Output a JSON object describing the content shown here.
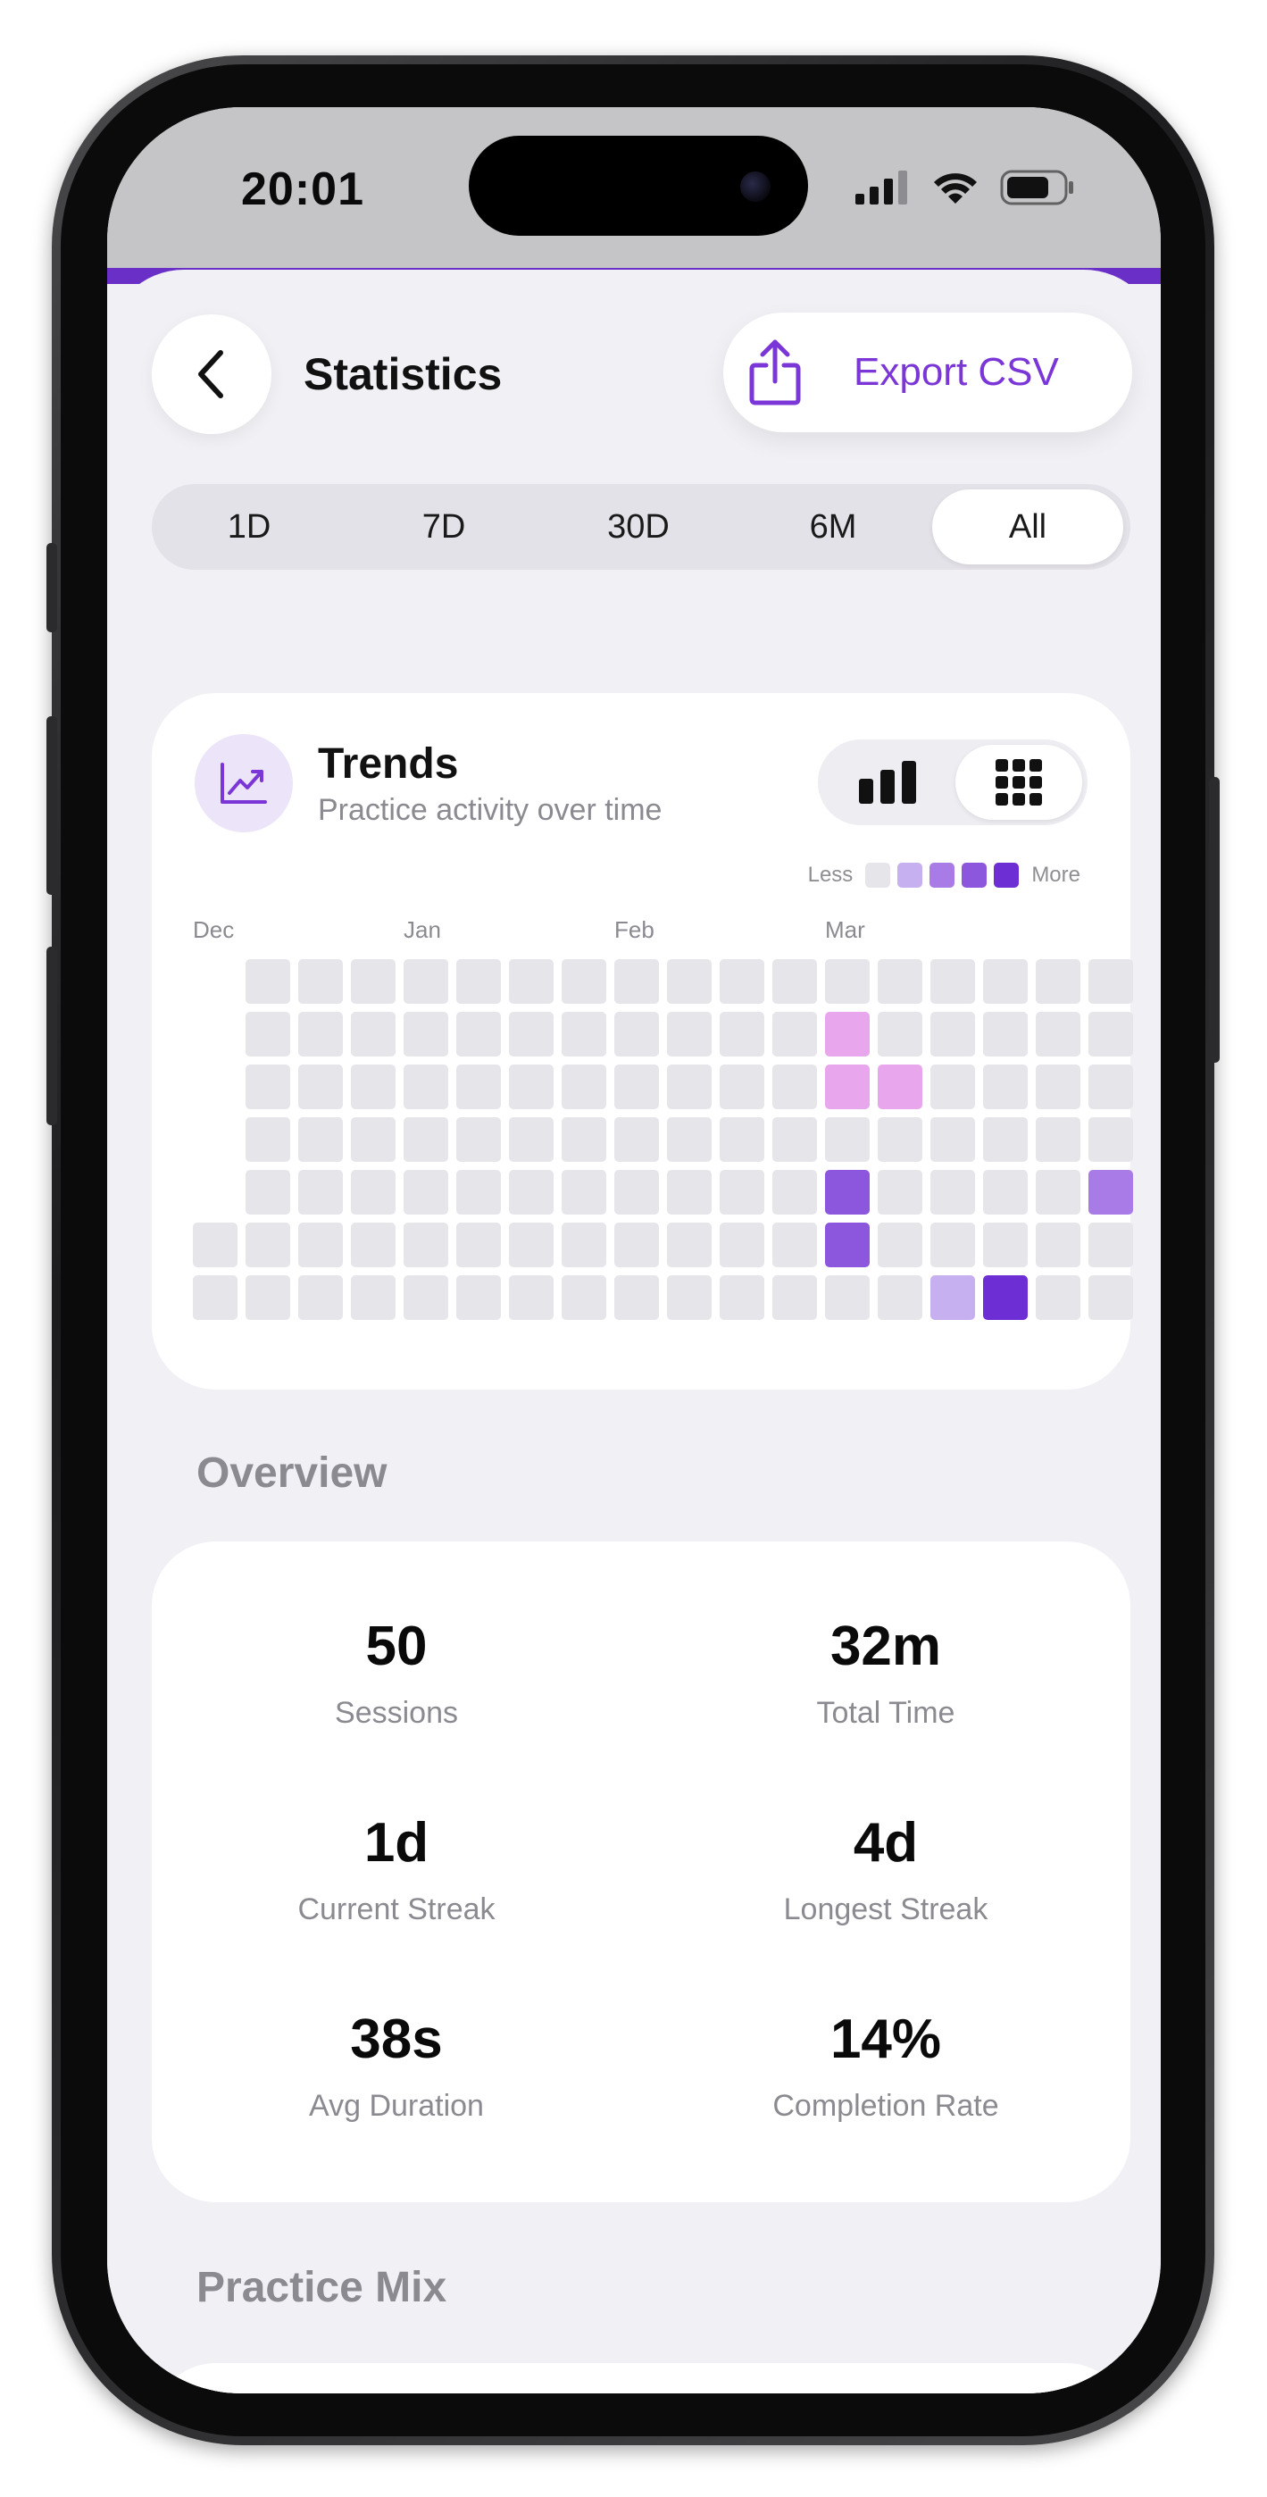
{
  "status_bar": {
    "time": "20:01"
  },
  "nav": {
    "title": "Statistics",
    "export_label": "Export CSV"
  },
  "ranges": [
    {
      "label": "1D",
      "active": false
    },
    {
      "label": "7D",
      "active": false
    },
    {
      "label": "30D",
      "active": false
    },
    {
      "label": "6M",
      "active": false
    },
    {
      "label": "All",
      "active": true
    }
  ],
  "trends": {
    "title": "Trends",
    "subtitle": "Practice activity over time",
    "view_modes": [
      {
        "icon": "bar-chart-icon",
        "active": false
      },
      {
        "icon": "grid-icon",
        "active": true
      }
    ],
    "legend": {
      "less": "Less",
      "more": "More"
    },
    "months": [
      {
        "label": "Dec",
        "week": 0
      },
      {
        "label": "Jan",
        "week": 4
      },
      {
        "label": "Feb",
        "week": 8
      },
      {
        "label": "Mar",
        "week": 12
      }
    ]
  },
  "chart_data": {
    "type": "heatmap",
    "x_labels": [
      "Dec",
      "Jan",
      "Feb",
      "Mar"
    ],
    "legend": [
      "Less",
      "More"
    ],
    "levels": [
      "#e6e5ea",
      "#c7b0ef",
      "#a97be6",
      "#8c57dd",
      "#6d2fd3"
    ],
    "highlight_colors": {
      "pink": "#e8a6ec"
    },
    "weeks": 17,
    "days_per_week": 7,
    "first_week_start_day": 5,
    "last_week_end_day": 6,
    "active_cells": [
      {
        "week": 12,
        "day": 1,
        "color": "pink"
      },
      {
        "week": 12,
        "day": 2,
        "color": "pink"
      },
      {
        "week": 13,
        "day": 2,
        "color": "pink"
      },
      {
        "week": 12,
        "day": 4,
        "level": 3
      },
      {
        "week": 17,
        "day": 4,
        "level": 2
      },
      {
        "week": 12,
        "day": 5,
        "level": 3
      },
      {
        "week": 14,
        "day": 6,
        "level": 1
      },
      {
        "week": 15,
        "day": 6,
        "level": 4
      }
    ]
  },
  "overview": {
    "title": "Overview",
    "stats": [
      {
        "value": "50",
        "label": "Sessions"
      },
      {
        "value": "32m",
        "label": "Total Time"
      },
      {
        "value": "1d",
        "label": "Current Streak"
      },
      {
        "value": "4d",
        "label": "Longest Streak"
      },
      {
        "value": "38s",
        "label": "Avg Duration"
      },
      {
        "value": "14%",
        "label": "Completion Rate"
      }
    ]
  },
  "practice_mix": {
    "title": "Practice Mix"
  },
  "colors": {
    "accent": "#7a36d6",
    "strip": "#6a2fc7",
    "background": "#f1f0f5"
  }
}
